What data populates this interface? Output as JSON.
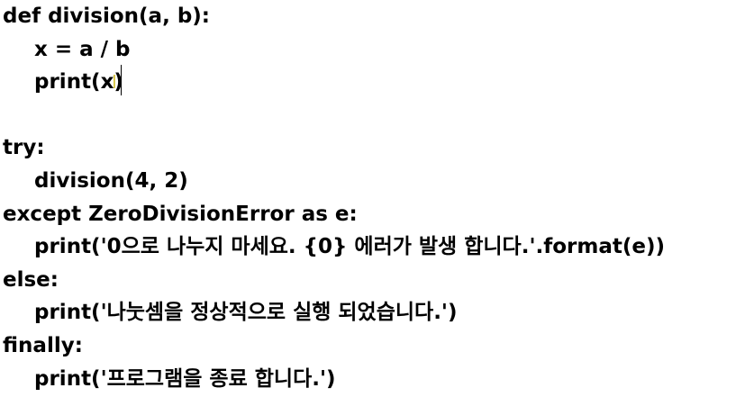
{
  "code": {
    "line1": "def division(a, b):",
    "line2": "x = a / b",
    "line3": "print(x)",
    "line5": "try:",
    "line6": "division(4, 2)",
    "line7": "except ZeroDivisionError as e:",
    "line8": "print('0으로 나누지 마세요. {0} 에러가 발생 합니다.'.format(e))",
    "line9": "else:",
    "line10": "print('나눗셈을 정상적으로 실행 되었습니다.')",
    "line11": "finally:",
    "line12": "print('프로그램을 종료 합니다.')"
  },
  "editor": {
    "cursor_icon": "text-cursor-icon",
    "caret_color": "#d8c84a"
  }
}
